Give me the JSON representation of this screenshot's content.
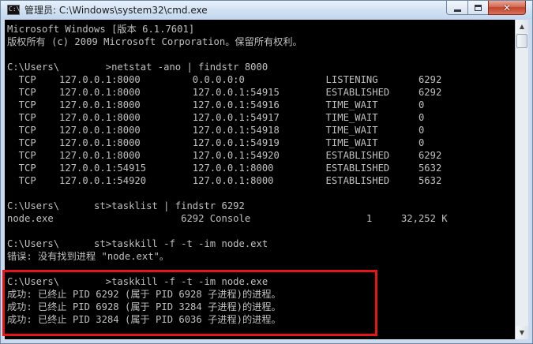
{
  "window": {
    "title": "管理员: C:\\Windows\\system32\\cmd.exe",
    "icon": "cmd-icon",
    "close_glyph": "✕"
  },
  "console": {
    "lines": [
      "Microsoft Windows [版本 6.1.7601]",
      "版权所有 (c) 2009 Microsoft Corporation。保留所有权利。",
      "",
      "C:\\Users\\        >netstat -ano | findstr 8000",
      "  TCP    127.0.0.1:8000         0.0.0.0:0              LISTENING       6292",
      "  TCP    127.0.0.1:8000         127.0.0.1:54915        ESTABLISHED     6292",
      "  TCP    127.0.0.1:8000         127.0.0.1:54916        TIME_WAIT       0",
      "  TCP    127.0.0.1:8000         127.0.0.1:54917        TIME_WAIT       0",
      "  TCP    127.0.0.1:8000         127.0.0.1:54918        TIME_WAIT       0",
      "  TCP    127.0.0.1:8000         127.0.0.1:54919        TIME_WAIT       0",
      "  TCP    127.0.0.1:8000         127.0.0.1:54920        ESTABLISHED     6292",
      "  TCP    127.0.0.1:54915        127.0.0.1:8000         ESTABLISHED     5632",
      "  TCP    127.0.0.1:54920        127.0.0.1:8000         ESTABLISHED     5632",
      "",
      "C:\\Users\\      st>tasklist | findstr 6292",
      "node.exe                      6292 Console                    1     32,252 K",
      "",
      "C:\\Users\\      st>taskkill -f -t -im node.ext",
      "错误: 没有找到进程 \"node.ext\"。",
      "",
      "C:\\Users\\        >taskkill -f -t -im node.exe",
      "成功: 已终止 PID 6292 (属于 PID 6928 子进程)的进程。",
      "成功: 已终止 PID 6928 (属于 PID 3284 子进程)的进程。",
      "成功: 已终止 PID 3284 (属于 PID 6036 子进程)的进程。"
    ]
  },
  "colors": {
    "console_bg": "#000000",
    "console_text": "#c0c0c0",
    "highlight": "#e8141c"
  }
}
